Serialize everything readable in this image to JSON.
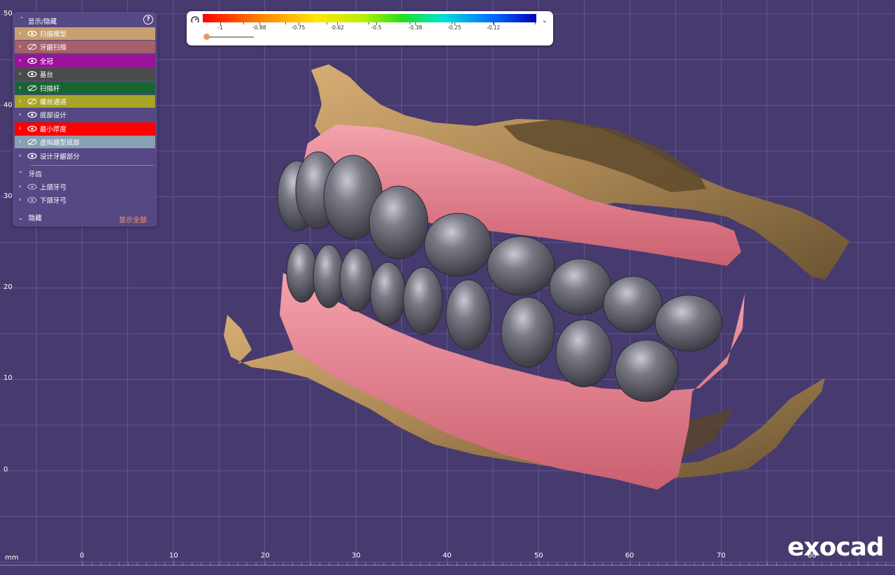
{
  "panel": {
    "title": "显示/隐藏",
    "items": [
      {
        "label": "扫描模型",
        "bg": "#c8a070",
        "visible": true
      },
      {
        "label": "牙龈扫描",
        "bg": "#a5606a",
        "visible": false
      },
      {
        "label": "全冠",
        "bg": "#9a139a",
        "visible": true
      },
      {
        "label": "基台",
        "bg": "#4a4a4a",
        "visible": true
      },
      {
        "label": "扫描杆",
        "bg": "#1a6434",
        "visible": false
      },
      {
        "label": "螺丝通道",
        "bg": "#a8a428",
        "visible": false
      },
      {
        "label": "底部设计",
        "bg": "",
        "visible": true
      },
      {
        "label": "最小厚度",
        "bg": "#ff0000",
        "visible": true
      },
      {
        "label": "虚拟蜡型底部",
        "bg": "#8aa0b2",
        "visible": false
      },
      {
        "label": "设计牙龈部分",
        "bg": "",
        "visible": true
      }
    ],
    "teeth_section": "牙齿",
    "teeth_items": [
      {
        "label": "上颌牙弓"
      },
      {
        "label": "下颌牙弓"
      }
    ],
    "hidden_section": "隐藏",
    "show_all": "显示全部"
  },
  "colorbar": {
    "labels": [
      "-1",
      "-0.88",
      "-0.75",
      "-0.62",
      "-0.5",
      "-0.38",
      "-0.25",
      "-0.12"
    ],
    "slider_value": 0
  },
  "axes": {
    "unit": "mm",
    "x_labels": [
      "0",
      "10",
      "20",
      "30",
      "40",
      "50",
      "60",
      "70",
      "80"
    ],
    "y_labels": [
      "50",
      "40",
      "30",
      "20",
      "10",
      "0"
    ]
  },
  "logo": "exocad"
}
